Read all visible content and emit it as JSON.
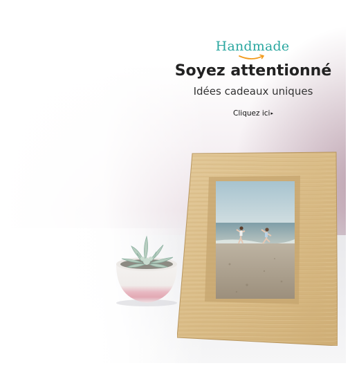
{
  "banner": {
    "brand": "Handmade",
    "headline": "Soyez attentionné",
    "subheading": "Idées cadeaux uniques",
    "cta_label": "Cliquez ici",
    "cta_arrow": "▸"
  },
  "colors": {
    "brand_teal": "#2aa7a0",
    "amazon_smile_orange": "#f29a1b",
    "headline": "#222222",
    "frame_wood": "#dcc08e",
    "background_mauve": "#eadfe5"
  },
  "icons": {
    "brand_smile": "amazon-smile-arrow",
    "cta_arrow": "caret-right"
  }
}
